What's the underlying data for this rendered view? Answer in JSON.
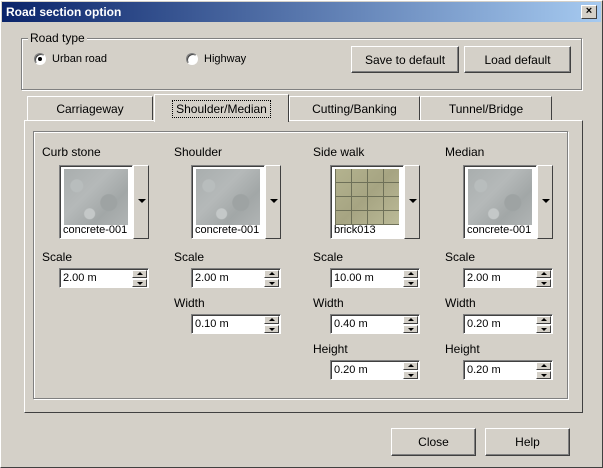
{
  "window": {
    "title": "Road section option",
    "close_glyph": "×"
  },
  "road_type": {
    "group_label": "Road type",
    "options": [
      {
        "label": "Urban road",
        "selected": true
      },
      {
        "label": "Highway",
        "selected": false
      }
    ],
    "save_default_label": "Save to default",
    "load_default_label": "Load default"
  },
  "tabs": [
    {
      "label": "Carriageway",
      "active": false
    },
    {
      "label": "Shoulder/Median",
      "active": true
    },
    {
      "label": "Cutting/Banking",
      "active": false
    },
    {
      "label": "Tunnel/Bridge",
      "active": false
    }
  ],
  "columns": {
    "curb": {
      "title": "Curb stone",
      "material": "concrete-001",
      "scale_label": "Scale",
      "scale_value": "2.00 m"
    },
    "shoulder": {
      "title": "Shoulder",
      "material": "concrete-001",
      "scale_label": "Scale",
      "scale_value": "2.00 m",
      "width_label": "Width",
      "width_value": "0.10 m"
    },
    "sidewalk": {
      "title": "Side walk",
      "material": "brick013",
      "scale_label": "Scale",
      "scale_value": "10.00 m",
      "width_label": "Width",
      "width_value": "0.40 m",
      "height_label": "Height",
      "height_value": "0.20 m"
    },
    "median": {
      "title": "Median",
      "material": "concrete-001",
      "scale_label": "Scale",
      "scale_value": "2.00 m",
      "width_label": "Width",
      "width_value": "0.20 m",
      "height_label": "Height",
      "height_value": "0.20 m"
    }
  },
  "footer": {
    "close_label": "Close",
    "help_label": "Help"
  },
  "colors": {
    "face": "#d4d0c8",
    "title_start": "#0a246a",
    "title_end": "#a6caf0"
  },
  "icons": {
    "close": "close-icon",
    "dropdown": "dropdown-arrow-icon",
    "spin_up": "spin-up-icon",
    "spin_down": "spin-down-icon"
  }
}
